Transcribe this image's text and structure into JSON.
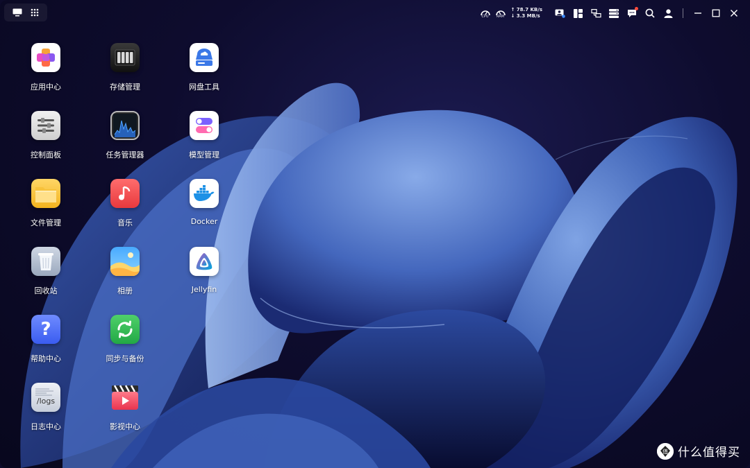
{
  "topbar": {
    "left_icons": [
      "show-desktop-icon",
      "app-launcher-icon"
    ],
    "cpu_label": "CPU",
    "ram_label": "RAM",
    "upload_speed": "↑ 78.7 KB/s",
    "download_speed": "↓ 3.3 MB/s",
    "right_icons": [
      "user-session-icon",
      "widgets-icon",
      "network-icon",
      "storage-status-icon",
      "messages-icon",
      "search-icon",
      "account-icon"
    ],
    "window_controls": [
      "minimize-icon",
      "maximize-icon",
      "close-icon"
    ]
  },
  "apps": [
    {
      "name": "app-center",
      "label": "应用中心"
    },
    {
      "name": "storage-manager",
      "label": "存储管理"
    },
    {
      "name": "cloud-drive-tool",
      "label": "网盘工具"
    },
    {
      "name": "control-panel",
      "label": "控制面板"
    },
    {
      "name": "task-manager",
      "label": "任务管理器"
    },
    {
      "name": "model-manager",
      "label": "模型管理"
    },
    {
      "name": "file-manager",
      "label": "文件管理"
    },
    {
      "name": "music",
      "label": "音乐"
    },
    {
      "name": "docker",
      "label": "Docker"
    },
    {
      "name": "recycle-bin",
      "label": "回收站"
    },
    {
      "name": "photos",
      "label": "相册"
    },
    {
      "name": "jellyfin",
      "label": "Jellyfin"
    },
    {
      "name": "help-center",
      "label": "帮助中心"
    },
    {
      "name": "sync-backup",
      "label": "同步与备份"
    },
    {
      "name": "log-center",
      "label": "日志中心",
      "icon_text": "/logs"
    },
    {
      "name": "video-center",
      "label": "影视中心"
    }
  ],
  "help_icon_text": "?",
  "watermark": {
    "text": "什么值得买",
    "badge_text": "值"
  },
  "colors": {
    "background": "#0d0b2a",
    "wave_light": "#6b93dc",
    "wave_dark": "#14225e"
  }
}
